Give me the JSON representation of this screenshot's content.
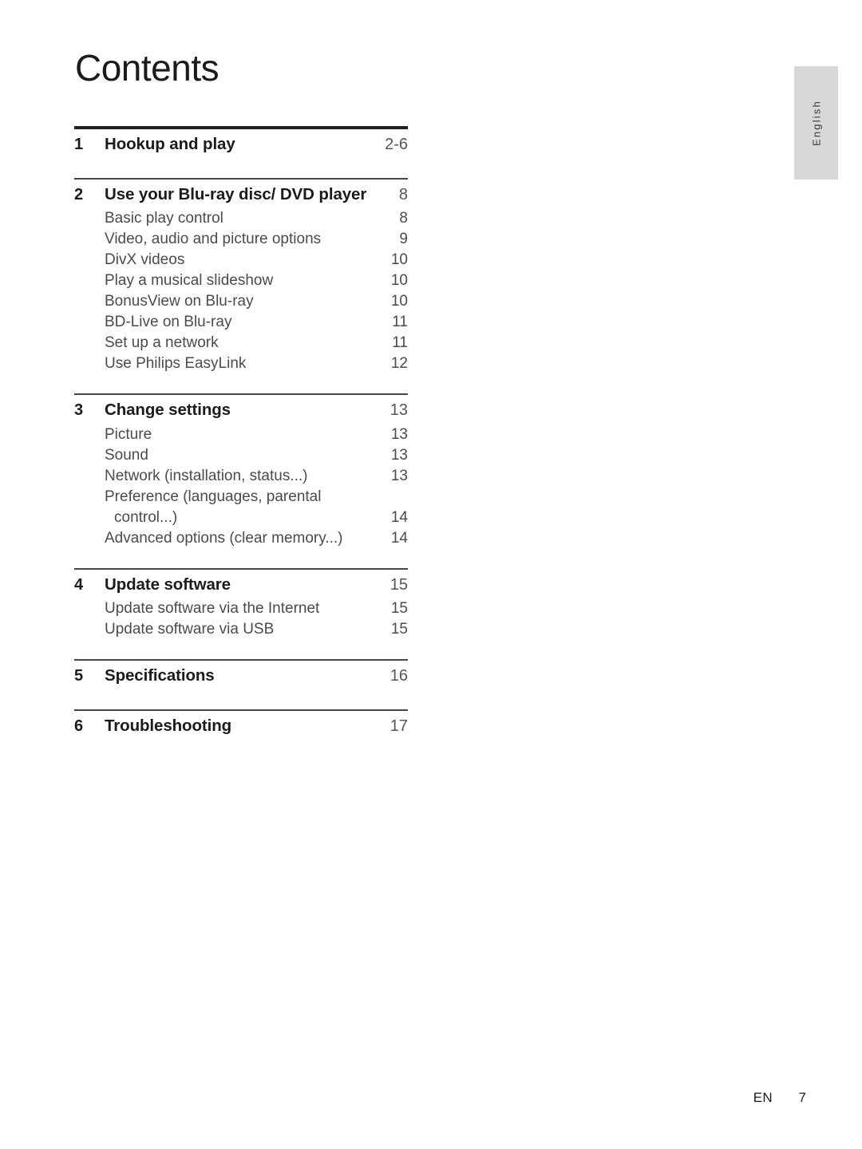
{
  "page_title": "Contents",
  "side_tab": {
    "label": "English"
  },
  "footer": {
    "language_code": "EN",
    "page_number": "7"
  },
  "colors": {
    "text_dark": "#1b1b1b",
    "text_gray": "#4d4a49",
    "rule_thick": "#232020",
    "rule_thin": "#4a4544",
    "side_tab_bg": "#d7d8da"
  },
  "sections": [
    {
      "rule": "thick",
      "chapter": {
        "number": "1",
        "title": "Hookup and play",
        "page": "2-6"
      },
      "entries": []
    },
    {
      "rule": "thin",
      "chapter": {
        "number": "2",
        "title": "Use your Blu-ray disc/ DVD player",
        "page": "8"
      },
      "entries": [
        {
          "label": "Basic play control",
          "page": "8"
        },
        {
          "label": "Video, audio and picture options",
          "page": "9"
        },
        {
          "label": "DivX videos",
          "page": "10"
        },
        {
          "label": "Play a musical slideshow",
          "page": "10"
        },
        {
          "label": "BonusView on Blu-ray",
          "page": "10"
        },
        {
          "label": "BD-Live on Blu-ray",
          "page": "11"
        },
        {
          "label": "Set up a network",
          "page": "11"
        },
        {
          "label": "Use Philips EasyLink",
          "page": "12"
        }
      ]
    },
    {
      "rule": "thin",
      "chapter": {
        "number": "3",
        "title": "Change settings",
        "page": "13"
      },
      "entries": [
        {
          "label": "Picture",
          "page": "13"
        },
        {
          "label": "Sound",
          "page": "13"
        },
        {
          "label": "Network (installation, status...)",
          "page": "13"
        },
        {
          "label": "Preference (languages, parental",
          "page": "",
          "continued": true
        },
        {
          "label": "control...)",
          "page": "14",
          "continuation": true
        },
        {
          "label": "Advanced options (clear memory...)",
          "page": "14"
        }
      ]
    },
    {
      "rule": "thin",
      "chapter": {
        "number": "4",
        "title": "Update software",
        "page": "15"
      },
      "entries": [
        {
          "label": "Update software via the Internet",
          "page": "15"
        },
        {
          "label": "Update software via USB",
          "page": "15"
        }
      ]
    },
    {
      "rule": "thin",
      "chapter": {
        "number": "5",
        "title": "Specifications",
        "page": "16"
      },
      "entries": []
    },
    {
      "rule": "thin",
      "chapter": {
        "number": "6",
        "title": "Troubleshooting",
        "page": "17"
      },
      "entries": []
    }
  ]
}
